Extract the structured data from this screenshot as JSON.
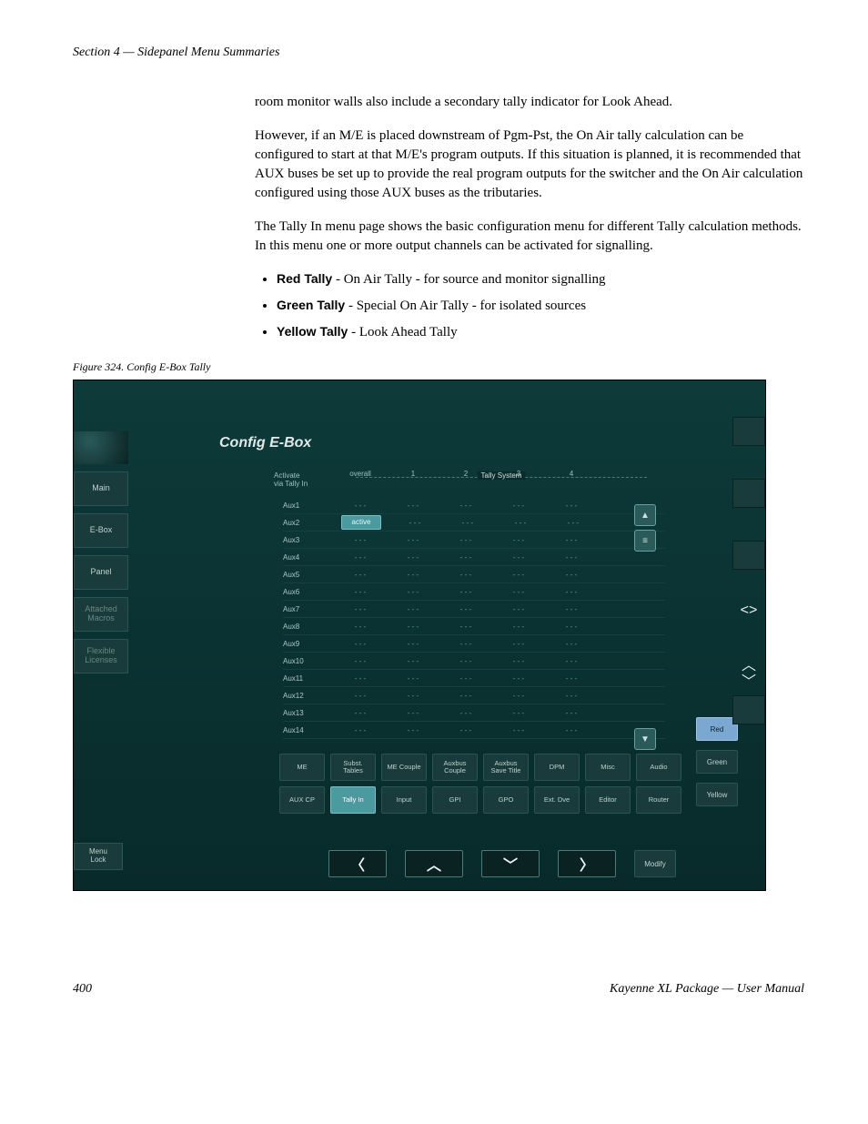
{
  "header": "Section 4 — Sidepanel Menu Summaries",
  "paragraphs": {
    "p1": "room monitor walls also include a secondary tally indicator for Look Ahead.",
    "p2": "However, if an M/E is placed downstream of Pgm-Pst, the On Air tally calculation can be configured to start at that M/E's program outputs. If this situation is planned, it is recommended that AUX buses be set up to provide the real program outputs for the switcher and the On Air calculation configured using those AUX buses as the tributaries.",
    "p3": "The Tally In menu page shows the basic configuration menu for different Tally calculation methods. In this menu one or more output channels can be activated for signalling."
  },
  "bullets": [
    {
      "label": "Red Tally",
      "desc": " - On Air Tally - for source and monitor signalling"
    },
    {
      "label": "Green Tally",
      "desc": " - Special On Air Tally - for isolated sources"
    },
    {
      "label": "Yellow Tally",
      "desc": " - Look Ahead Tally"
    }
  ],
  "figure_caption": "Figure 324.  Config E-Box Tally",
  "screenshot": {
    "title": "Config E-Box",
    "sidebar": [
      "Main",
      "E-Box",
      "Panel",
      "Attached Macros",
      "Flexible Licenses"
    ],
    "table": {
      "activate_label": "Activate\nvia Tally In",
      "group_label": "Tally System",
      "columns": [
        "overall",
        "1",
        "2",
        "3",
        "4"
      ],
      "rows": [
        "Aux1",
        "Aux2",
        "Aux3",
        "Aux4",
        "Aux5",
        "Aux6",
        "Aux7",
        "Aux8",
        "Aux9",
        "Aux10",
        "Aux11",
        "Aux12",
        "Aux13",
        "Aux14"
      ],
      "active_cell": {
        "row": 1,
        "col": 0,
        "text": "active"
      },
      "placeholder": "- - -"
    },
    "button_rows": [
      [
        "ME",
        "Subst. Tables",
        "ME Couple",
        "Auxbus Couple",
        "Auxbus Save Title",
        "DPM",
        "Misc",
        "Audio"
      ],
      [
        "AUX CP",
        "Tally In",
        "Input",
        "GPI",
        "GPO",
        "Ext. Dve",
        "Editor",
        "Router"
      ]
    ],
    "selected_button": "Tally In",
    "color_buttons": [
      "Red",
      "Green",
      "Yellow"
    ],
    "selected_color": "Red",
    "menu_lock": "Menu\nLock",
    "modify": "Modify"
  },
  "footer": {
    "page": "400",
    "title": "Kayenne XL Package  —  User Manual"
  }
}
